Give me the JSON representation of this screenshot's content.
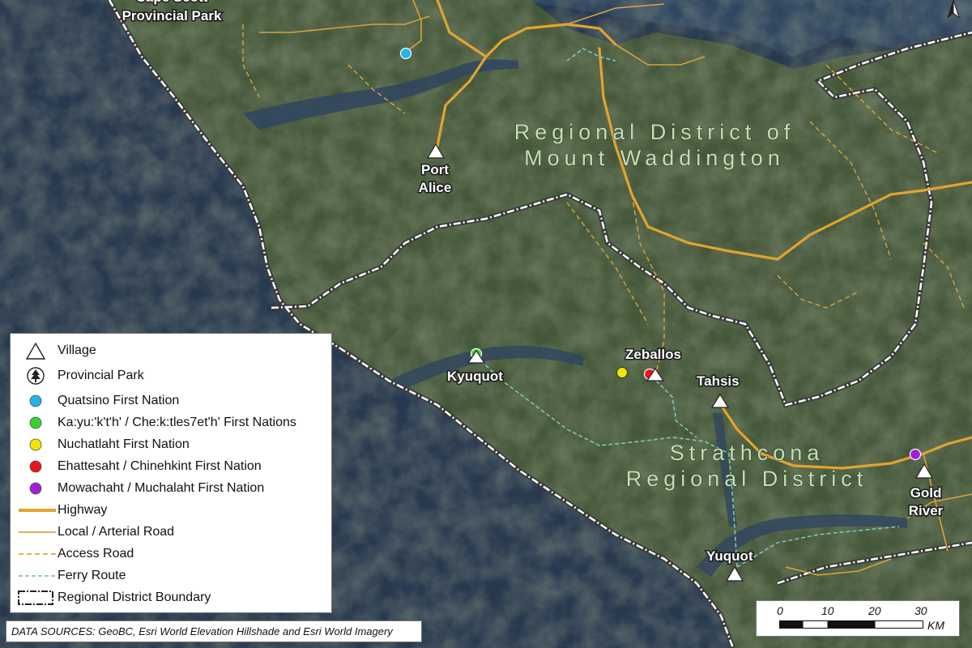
{
  "colors": {
    "ocean": "#27384f",
    "land": "#45573a",
    "highway": "#e2a32f",
    "local_road": "#d9a23e",
    "access_road": "#e0a43a",
    "ferry": "#7fc5c0",
    "boundary": "#ffffff",
    "region_label": "#c7ddb8",
    "quatsino": "#22b5e8",
    "kyuquot_fn": "#35d22e",
    "nuchatlaht": "#f2e600",
    "ehattesaht": "#e8161b",
    "mowachaht": "#a21fd8"
  },
  "map": {
    "places": [
      {
        "id": "cape-scott",
        "label": "Cape Scott Provincial Park"
      },
      {
        "id": "port-alice",
        "label": "Port Alice"
      },
      {
        "id": "kyuquot",
        "label": "Kyuquot"
      },
      {
        "id": "zeballos",
        "label": "Zeballos"
      },
      {
        "id": "tahsis",
        "label": "Tahsis"
      },
      {
        "id": "yuquot",
        "label": "Yuquot"
      },
      {
        "id": "gold-river",
        "label": "Gold River"
      }
    ],
    "regions": [
      {
        "id": "mount-waddington",
        "line1": "Regional District of",
        "line2": "Mount Waddington"
      },
      {
        "id": "strathcona",
        "line1": "Strathcona",
        "line2": "Regional District"
      }
    ]
  },
  "legend": {
    "items": [
      {
        "symbol": "village-triangle",
        "label": "Village"
      },
      {
        "symbol": "provincial-park-tree",
        "label": "Provincial Park"
      },
      {
        "symbol": "dot",
        "color": "#22b5e8",
        "label": "Quatsino First Nation"
      },
      {
        "symbol": "dot",
        "color": "#35d22e",
        "label": "Ka:yu:'k't'h' / Che:k:tles7et'h' First Nations"
      },
      {
        "symbol": "dot",
        "color": "#f2e600",
        "label": "Nuchatlaht First Nation"
      },
      {
        "symbol": "dot",
        "color": "#e8161b",
        "label": "Ehattesaht / Chinehkint First Nation"
      },
      {
        "symbol": "dot",
        "color": "#a21fd8",
        "label": "Mowachaht / Muchalaht First Nation"
      },
      {
        "symbol": "highway-line",
        "label": "Highway"
      },
      {
        "symbol": "local-road-line",
        "label": "Local / Arterial Road"
      },
      {
        "symbol": "access-road-dashed",
        "label": "Access Road"
      },
      {
        "symbol": "ferry-dashed",
        "label": "Ferry Route"
      },
      {
        "symbol": "boundary-box",
        "label": "Regional District Boundary"
      }
    ]
  },
  "sources": "DATA SOURCES: GeoBC, Esri World Elevation Hillshade and Esri World Imagery",
  "scale": {
    "ticks": [
      "0",
      "10",
      "20",
      "30"
    ],
    "unit": "KM"
  }
}
